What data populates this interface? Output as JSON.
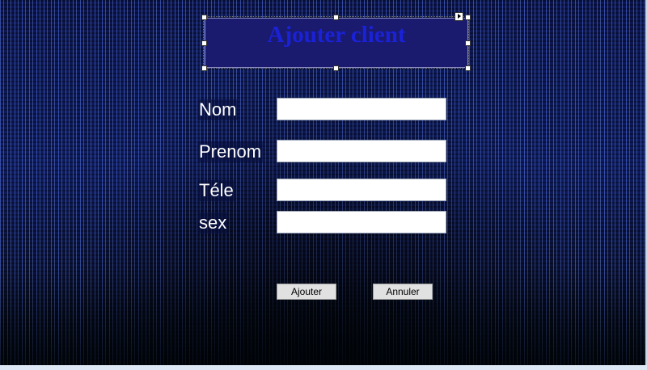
{
  "form": {
    "title": "Ajouter client",
    "fields": [
      {
        "label": "Nom",
        "value": "",
        "placeholder": ""
      },
      {
        "label": "Prenom",
        "value": "",
        "placeholder": ""
      },
      {
        "label": "Téle",
        "value": "",
        "placeholder": ""
      },
      {
        "label": "sex",
        "value": "",
        "placeholder": ""
      }
    ],
    "buttons": {
      "add_label": "Ajouter",
      "cancel_label": "Annuler"
    }
  },
  "colors": {
    "title_background": "#1a1a6e",
    "title_text": "#1a22d8",
    "label_text": "#ffffff",
    "background_theme": "#0e1d62"
  },
  "icons": [
    "selection-handle-icon",
    "smart-tag-arrow-icon"
  ]
}
